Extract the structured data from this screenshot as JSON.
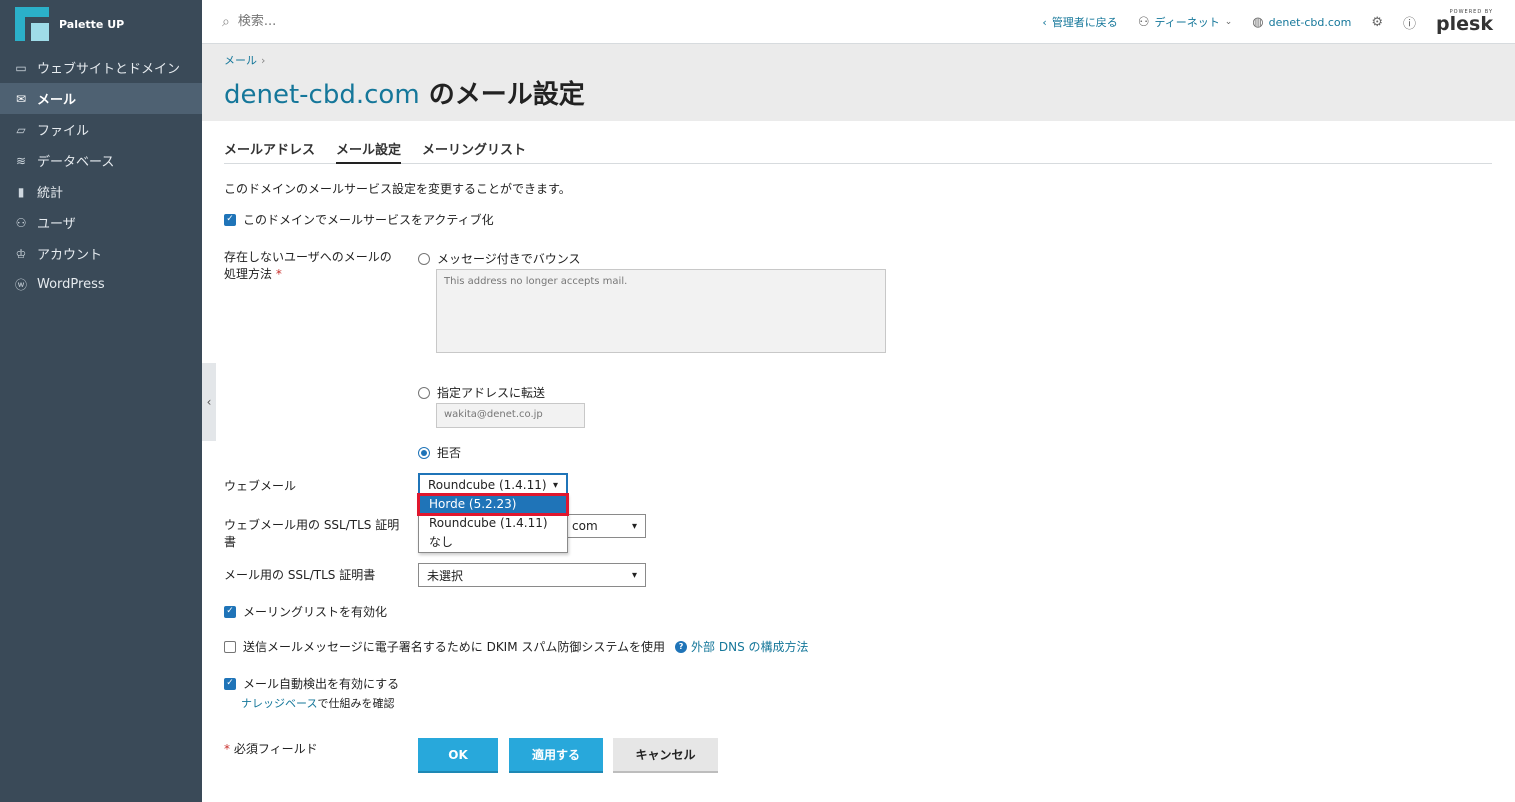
{
  "sidebar": {
    "brand": "Palette UP",
    "items": [
      {
        "label": "ウェブサイトとドメイン",
        "icon": "monitor-icon"
      },
      {
        "label": "メール",
        "icon": "mail-icon"
      },
      {
        "label": "ファイル",
        "icon": "folder-icon"
      },
      {
        "label": "データベース",
        "icon": "database-icon"
      },
      {
        "label": "統計",
        "icon": "bar-chart-icon"
      },
      {
        "label": "ユーザ",
        "icon": "user-icon"
      },
      {
        "label": "アカウント",
        "icon": "account-icon"
      },
      {
        "label": "WordPress",
        "icon": "wordpress-icon"
      }
    ],
    "active_index": 1
  },
  "topbar": {
    "search_placeholder": "検索...",
    "back_admin": "管理者に戻る",
    "user": "ディーネット",
    "domain": "denet-cbd.com",
    "powered_by": "POWERED BY",
    "plesk": "plesk"
  },
  "header": {
    "breadcrumb": "メール",
    "title_domain": "denet-cbd.com",
    "title_suffix": " のメール設定"
  },
  "tabs": [
    {
      "label": "メールアドレス"
    },
    {
      "label": "メール設定"
    },
    {
      "label": "メーリングリスト"
    }
  ],
  "form": {
    "description": "このドメインのメールサービス設定を変更することができます。",
    "activate_mail": "このドメインでメールサービスをアクティブ化",
    "nonexistent_label_1": "存在しないユーザへのメールの",
    "nonexistent_label_2": "処理方法",
    "required_mark": "*",
    "bounce_label": "メッセージ付きでバウンス",
    "bounce_message": "This address no longer accepts mail.",
    "forward_label": "指定アドレスに転送",
    "forward_address": "wakita@denet.co.jp",
    "reject_label": "拒否",
    "webmail_label": "ウェブメール",
    "webmail_selected": "Roundcube (1.4.11)",
    "webmail_options": [
      "Horde (5.2.23)",
      "Roundcube (1.4.11)",
      "なし"
    ],
    "webmail_ssl_label_1": "ウェブメール用の SSL/TLS 証明",
    "webmail_ssl_label_2": "書",
    "webmail_ssl_value": "com",
    "mail_ssl_label": "メール用の SSL/TLS 証明書",
    "mail_ssl_value": "未選択",
    "mailing_list": "メーリングリストを有効化",
    "dkim": "送信メールメッセージに電子署名するために DKIM スパム防御システムを使用",
    "dns_help": "外部 DNS の構成方法",
    "autodiscover": "メール自動検出を有効にする",
    "kb_link": "ナレッジベース",
    "kb_suffix": "で仕組みを確認",
    "required_fields": "必須フィールド"
  },
  "buttons": {
    "ok": "OK",
    "apply": "適用する",
    "cancel": "キャンセル"
  },
  "colors": {
    "sidebar_bg": "#3a4a58",
    "accent": "#28a8db",
    "link": "#15779a",
    "highlight_outline": "#e0172e"
  }
}
